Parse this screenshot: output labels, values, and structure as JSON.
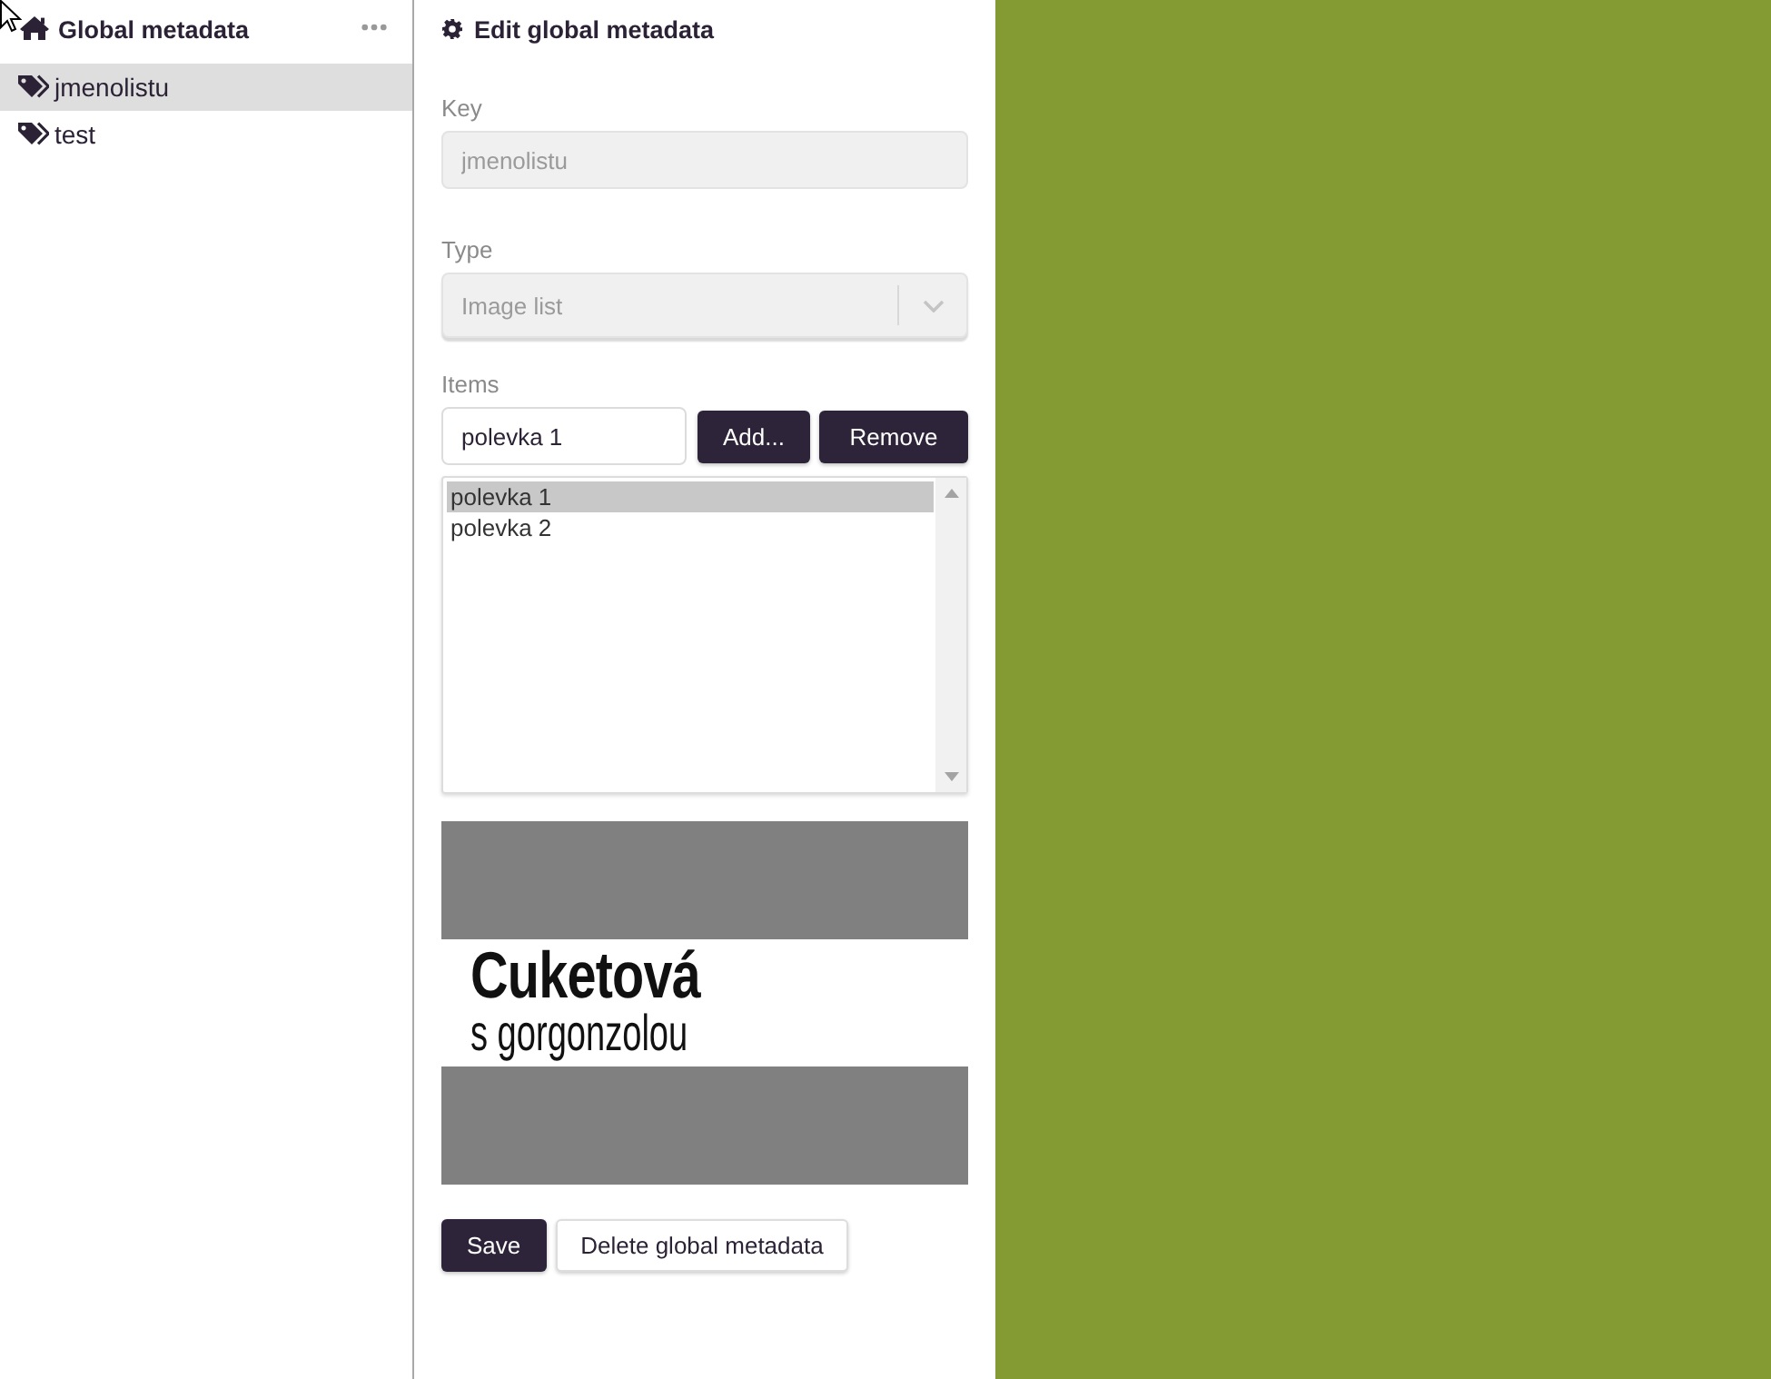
{
  "sidebar": {
    "title": "Global metadata",
    "items": [
      {
        "label": "jmenolistu",
        "selected": true
      },
      {
        "label": "test",
        "selected": false
      }
    ]
  },
  "editor": {
    "title": "Edit global metadata",
    "fields": [
      {
        "kind": "text",
        "label": "Key",
        "value": "jmenolistu",
        "disabled": true
      },
      {
        "kind": "select",
        "label": "Type",
        "value": "Image list",
        "disabled": true
      }
    ],
    "items": {
      "label": "Items",
      "input_value": "polevka 1",
      "buttons": [
        "Add...",
        "Remove"
      ],
      "options": [
        {
          "label": "polevka 1",
          "selected": true
        },
        {
          "label": "polevka 2",
          "selected": false
        }
      ]
    },
    "preview": {
      "title": "Cuketová",
      "subtitle": "s gorgonzolou"
    },
    "actions": [
      {
        "label": "Save",
        "kind": "primary"
      },
      {
        "label": "Delete global metadata",
        "kind": "secondary"
      }
    ]
  }
}
